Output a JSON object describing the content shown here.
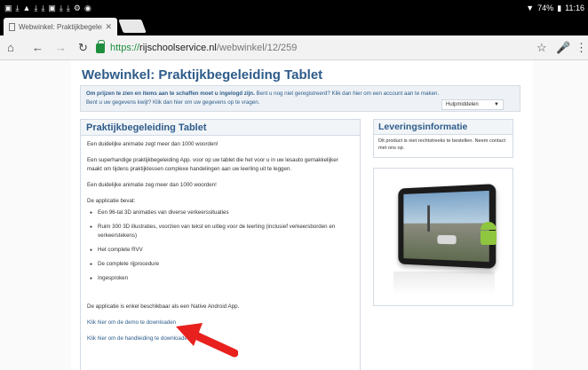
{
  "status_bar": {
    "battery": "74%",
    "time": "11:16"
  },
  "browser": {
    "tab_title": "Webwinkel: Praktijkbegeleid...",
    "url_scheme": "https://",
    "url_host": "rijschoolservice.nl",
    "url_path": "/webwinkel/12/259"
  },
  "page": {
    "title": "Webwinkel: Praktijkbegeleiding Tablet",
    "notice": {
      "bold": "Om prijzen te zien en items aan te schaffen moet u ingelogd zijn.",
      "text1": " Bent u nog niet geregistreerd? ",
      "link1": "Klik dan hier om een account aan te maken.",
      "text2": "Bent u uw gegevens kwijt? ",
      "link2": "Klik dan hier om uw gegevens op te vragen.",
      "dropdown": "Hulpmiddelen"
    },
    "main_box": {
      "header": "Praktijkbegeleiding Tablet",
      "p1": "Een duidelijke animatie zegt meer dan 1000 woorden!",
      "p2": "Een superhandige praktijkbegeleiding App. voor op uw tablet die het voor u in uw lesauto gemakkelijker maakt om tijdens praktijklessen complexe handelingen aan uw leerling uit te leggen.",
      "p3": "Een duidelijke animatie zeg meer dan 1000 woorden!",
      "p4": "De applicatie bevat:",
      "items": [
        "Een 96-tal 3D animaties van diverse verkeerssituaties",
        "Ruim 300 3D illustraties, voorzien van tekst en uitleg voor de leerling (inclusief verkeersborden en verkeerstekens)",
        "Het complete RVV",
        "De complete rijprocedure",
        "Ingesproken"
      ],
      "p5": "De applicatie is enkel beschikbaar als een Native Android App.",
      "link_demo": "Klik hier om de demo te downloaden",
      "link_manual": "Klik hier om de handleiding te downloaden"
    },
    "side_box": {
      "header": "Leveringsinformatie",
      "text": "Dit product is niet rechtstreeks te bestellen. Neem contact met ons op."
    }
  }
}
